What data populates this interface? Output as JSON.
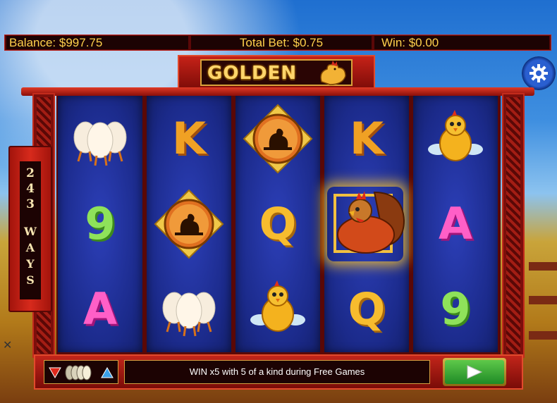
{
  "status": {
    "balance": "Balance: $997.75",
    "total_bet": "Total Bet: $0.75",
    "win": "Win: $0.00"
  },
  "logo": {
    "text": "GOLDEN"
  },
  "ways": {
    "number": [
      "2",
      "4",
      "3"
    ],
    "word": [
      "W",
      "A",
      "Y",
      "S"
    ]
  },
  "message": "WIN x5 with 5 of a kind during Free Games",
  "icons": {
    "settings": "gear-icon",
    "spin": "play-icon",
    "bet_down": "triangle-down-icon",
    "bet_up": "triangle-up-icon",
    "close": "close-icon"
  },
  "colors": {
    "accent": "#ffd24c",
    "frame": "#c32b1c",
    "reel_bg": "#1b2a8a"
  },
  "reels": [
    [
      "eggs",
      "9",
      "A"
    ],
    [
      "K",
      "rooster-medallion",
      "eggs"
    ],
    [
      "rooster-medallion",
      "Q",
      "chick"
    ],
    [
      "K",
      "rooster-win",
      "Q"
    ],
    [
      "chick",
      "A",
      "9"
    ]
  ]
}
